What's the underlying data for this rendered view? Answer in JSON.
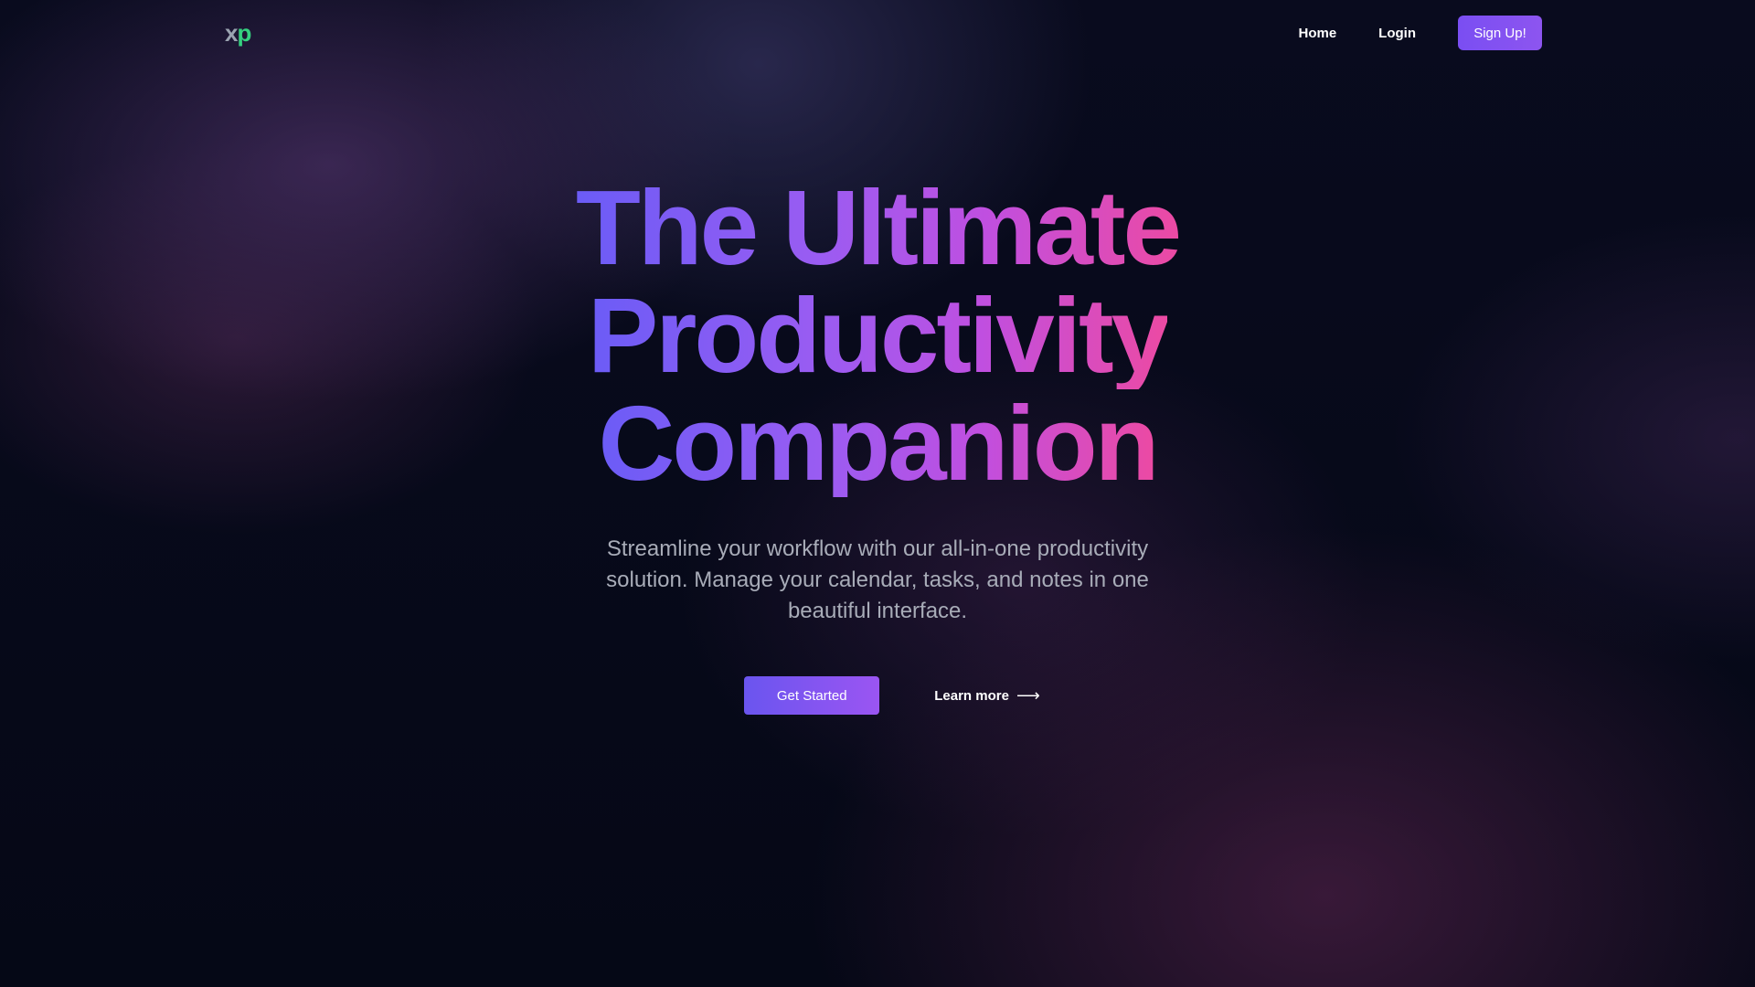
{
  "nav": {
    "logo_x": "x",
    "logo_p": "p",
    "links": [
      {
        "label": "Home"
      },
      {
        "label": "Login"
      }
    ],
    "signup_label": "Sign Up!"
  },
  "hero": {
    "title_lines": [
      "The Ultimate",
      "Productivity",
      "Companion"
    ],
    "subtitle": "Streamline your workflow with our all-in-one productivity solution. Manage your calendar, tasks, and notes in one beautiful interface.",
    "primary_cta": "Get Started",
    "secondary_cta": "Learn more",
    "secondary_cta_icon": "arrow-right-icon"
  },
  "colors": {
    "background": "#050816",
    "accent_purple": "#7a4ef2",
    "accent_pink": "#ec4aa3",
    "logo_green": "#35d07f",
    "subtitle_gray": "#a8acb8"
  }
}
